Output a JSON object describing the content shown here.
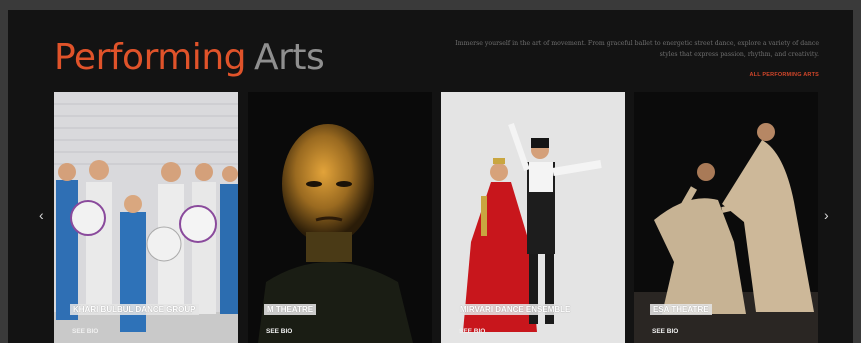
{
  "section": {
    "title_primary": "Performing",
    "title_secondary": "Arts",
    "description": "Immerse yourself in the art of movement. From graceful ballet to energetic street dance, explore a variety of dance styles that express passion, rhythm, and creativity.",
    "all_link": "ALL PERFORMING ARTS"
  },
  "carousel": {
    "prev_icon": "‹",
    "next_icon": "›",
    "cards": [
      {
        "name": "KHARI BULBUL DANCE GROUP",
        "link": "SEE BIO"
      },
      {
        "name": "M THEATRE",
        "link": "SEE BIO"
      },
      {
        "name": "MIRVARI DANCE ENSEMBLE",
        "link": "SEE BIO"
      },
      {
        "name": "ESA THEATRE",
        "link": "SEE BIO"
      }
    ]
  },
  "colors": {
    "accent": "#e0532a",
    "background": "#131313",
    "muted_text": "#8f8f8f"
  }
}
